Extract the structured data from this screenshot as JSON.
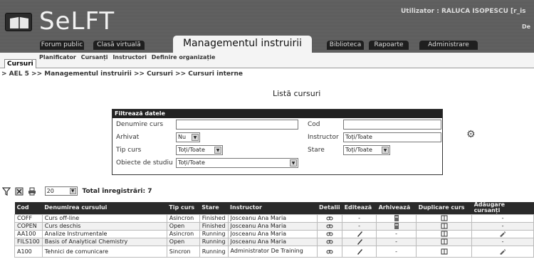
{
  "app": {
    "title": "SeLFT",
    "user_label": "Utilizator : RALUCA ISOPESCU [r_is",
    "header_extra": "De"
  },
  "main_tabs": [
    {
      "label": "Forum public"
    },
    {
      "label": "Clasă virtuală"
    },
    {
      "label": "Managementul instruirii"
    },
    {
      "label": "Biblioteca"
    },
    {
      "label": "Rapoarte"
    },
    {
      "label": "Administrare"
    }
  ],
  "sub_tabs": {
    "active": "Cursuri",
    "items": [
      "Planificator",
      "Cursanți",
      "Instructori",
      "Definire organizație"
    ]
  },
  "breadcrumb": "> AEL 5 >> Managementul instruirii >> Cursuri >> Cursuri interne",
  "page_title": "Listă cursuri",
  "filter": {
    "header": "Filtrează datele",
    "course_name_label": "Denumire curs",
    "course_name_value": "",
    "code_label": "Cod",
    "code_value": "",
    "archived_label": "Arhivat",
    "archived_value": "Nu",
    "instructor_label": "Instructor",
    "instructor_value": "Toți/Toate",
    "course_type_label": "Tip curs",
    "course_type_value": "Toți/Toate",
    "status_label": "Stare",
    "status_value": "Toți/Toate",
    "subjects_label": "Obiecte de studiu",
    "subjects_value": "Toți/Toate"
  },
  "toolbar": {
    "page_size": "20",
    "total_label": "Total înregistrări: 7"
  },
  "table": {
    "columns": [
      "Cod",
      "Denumirea cursului",
      "Tip curs",
      "Stare",
      "Instructor",
      "Detalii",
      "Editează",
      "Arhivează",
      "Duplicare curs",
      "Adăugare cursanți"
    ],
    "rows": [
      {
        "code": "COFF",
        "name": "Curs off-line",
        "type": "Asincron",
        "status": "Finished",
        "instructor": "Josceanu Ana Maria",
        "edit": "-",
        "archive": "icon",
        "add": "-"
      },
      {
        "code": "COPEN",
        "name": "Curs deschis",
        "type": "Open",
        "status": "Finished",
        "instructor": "Josceanu Ana Maria",
        "edit": "-",
        "archive": "icon",
        "add": "-"
      },
      {
        "code": "AA100",
        "name": "Analize Instrumentale",
        "type": "Asincron",
        "status": "Running",
        "instructor": "Josceanu Ana Maria",
        "edit": "icon",
        "archive": "-",
        "add": "icon"
      },
      {
        "code": "FILS100",
        "name": "Basis of Analytical Chemistry",
        "type": "Open",
        "status": "Running",
        "instructor": "Josceanu Ana Maria",
        "edit": "icon",
        "archive": "-",
        "add": "-"
      },
      {
        "code": "A100",
        "name": "Tehnici de comunicare",
        "type": "Sincron",
        "status": "Running",
        "instructor": "Administrator De Training",
        "edit": "icon",
        "archive": "-",
        "add": "icon"
      }
    ]
  }
}
